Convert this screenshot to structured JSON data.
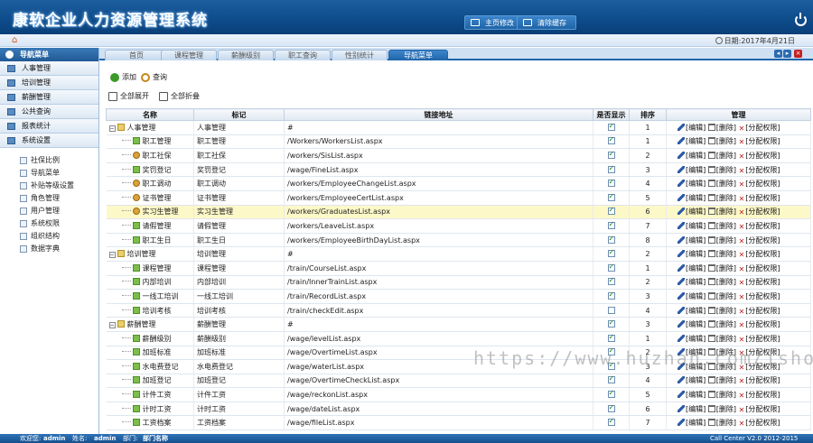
{
  "header": {
    "title": "康软企业人力资源管理系统",
    "btn_change_pwd": "主页修改",
    "btn_close_tabs": "清除缓存"
  },
  "subheader": {
    "date": "日期:2017年4月21日"
  },
  "sidebar": {
    "title": "导航菜单",
    "groups": [
      "人事管理",
      "培训管理",
      "薪酬管理",
      "公共查询",
      "报表统计",
      "系统设置"
    ],
    "subitems": [
      "社保比例",
      "导航菜单",
      "补贴等级设置",
      "角色管理",
      "用户管理",
      "系统权限",
      "组织结构",
      "数据字典"
    ]
  },
  "tabs": [
    "首页",
    "课程管理",
    "薪酬级别",
    "职工查询",
    "性别统计",
    "导航菜单"
  ],
  "toolbar": {
    "add": "添加",
    "query": "查询",
    "expand_all": "全部展开",
    "collapse_all": "全部折叠"
  },
  "grid": {
    "columns": [
      "名称",
      "标记",
      "链接地址",
      "是否显示",
      "排序",
      "管理"
    ],
    "ops": {
      "edit": "[编辑]",
      "delete": "[删除]",
      "perm": "[分配权限]"
    },
    "rows": [
      {
        "name": "人事管理",
        "mark": "人事管理",
        "url": "#",
        "show": true,
        "sort": "1"
      },
      {
        "name": "职工管理",
        "mark": "职工管理",
        "url": "/Workers/WorkersList.aspx",
        "show": true,
        "sort": "1"
      },
      {
        "name": "职工社保",
        "mark": "职工社保",
        "url": "/workers/SisList.aspx",
        "show": true,
        "sort": "2"
      },
      {
        "name": "奖罚登记",
        "mark": "奖罚登记",
        "url": "/wage/FineList.aspx",
        "show": true,
        "sort": "3"
      },
      {
        "name": "职工调动",
        "mark": "职工调动",
        "url": "/workers/EmployeeChangeList.aspx",
        "show": true,
        "sort": "4"
      },
      {
        "name": "证书管理",
        "mark": "证书管理",
        "url": "/workers/EmployeeCertList.aspx",
        "show": true,
        "sort": "5"
      },
      {
        "name": "实习生管理",
        "mark": "实习生管理",
        "url": "/workers/GraduatesList.aspx",
        "show": true,
        "sort": "6"
      },
      {
        "name": "请假管理",
        "mark": "请假管理",
        "url": "/workers/LeaveList.aspx",
        "show": true,
        "sort": "7"
      },
      {
        "name": "职工生日",
        "mark": "职工生日",
        "url": "/workers/EmployeeBirthDayList.aspx",
        "show": true,
        "sort": "8"
      },
      {
        "name": "培训管理",
        "mark": "培训管理",
        "url": "#",
        "show": true,
        "sort": "2"
      },
      {
        "name": "课程管理",
        "mark": "课程管理",
        "url": "/train/CourseList.aspx",
        "show": true,
        "sort": "1"
      },
      {
        "name": "内部培训",
        "mark": "内部培训",
        "url": "/train/InnerTrainList.aspx",
        "show": true,
        "sort": "2"
      },
      {
        "name": "一线工培训",
        "mark": "一线工培训",
        "url": "/train/RecordList.aspx",
        "show": true,
        "sort": "3"
      },
      {
        "name": "培训考核",
        "mark": "培训考核",
        "url": "/train/checkEdit.aspx",
        "show": false,
        "sort": "4"
      },
      {
        "name": "薪酬管理",
        "mark": "薪酬管理",
        "url": "#",
        "show": true,
        "sort": "3"
      },
      {
        "name": "薪酬级别",
        "mark": "薪酬级别",
        "url": "/wage/levelList.aspx",
        "show": true,
        "sort": "1"
      },
      {
        "name": "加班标准",
        "mark": "加班标准",
        "url": "/wage/OvertimeList.aspx",
        "show": true,
        "sort": "2"
      },
      {
        "name": "水电费登记",
        "mark": "水电费登记",
        "url": "/wage/waterList.aspx",
        "show": true,
        "sort": "3"
      },
      {
        "name": "加班登记",
        "mark": "加班登记",
        "url": "/wage/OvertimeCheckList.aspx",
        "show": true,
        "sort": "4"
      },
      {
        "name": "计件工资",
        "mark": "计件工资",
        "url": "/wage/reckonList.aspx",
        "show": true,
        "sort": "5"
      },
      {
        "name": "计时工资",
        "mark": "计时工资",
        "url": "/wage/dateList.aspx",
        "show": true,
        "sort": "6"
      },
      {
        "name": "工资档案",
        "mark": "工资档案",
        "url": "/wage/fileList.aspx",
        "show": true,
        "sort": "7"
      }
    ]
  },
  "watermark": "https://www.huzhan.com/ishop2095",
  "footer": {
    "welcome_label": "欢迎您:",
    "welcome_value": "admin",
    "name_label": "姓名:",
    "name_value": "admin",
    "dept_label": "部门:",
    "dept_value": "部门名称",
    "copyright": "Call Center V2.0 2012-2015"
  }
}
